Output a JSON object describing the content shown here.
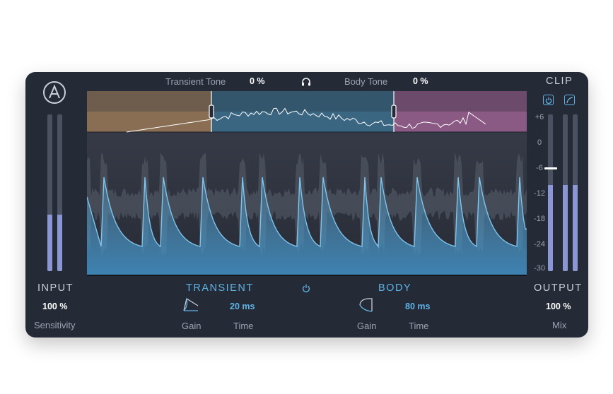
{
  "header": {
    "transient_tone_label": "Transient Tone",
    "transient_tone_value": "0 %",
    "body_tone_label": "Body Tone",
    "body_tone_value": "0 %",
    "clip_label": "CLIP"
  },
  "input": {
    "label": "INPUT",
    "value": "100 %",
    "caption": "Sensitivity",
    "level_left": 0.36,
    "level_right": 0.36
  },
  "output": {
    "label": "OUTPUT",
    "value": "100 %",
    "caption": "Mix",
    "level_left": 0.55,
    "level_right": 0.55,
    "gain_db": -6
  },
  "db_scale": [
    "+6",
    "0",
    "-6",
    "-12",
    "-18",
    "-24",
    "-30"
  ],
  "transient": {
    "label": "TRANSIENT",
    "gain_caption": "Gain",
    "time_caption": "Time",
    "time_value": "20 ms"
  },
  "body": {
    "label": "BODY",
    "gain_caption": "Gain",
    "time_caption": "Time",
    "time_value": "80 ms"
  },
  "colors": {
    "panel": "#242a36",
    "accent": "#5fb3e6",
    "meter_fill": "#8a97d4",
    "band_low": "#8a6e53",
    "band_mid": "#3a6682",
    "band_high": "#8a5a84"
  },
  "icons": {
    "logo": "arturia-logo",
    "monitor": "headphones-icon",
    "clip_power": "power-icon",
    "clip_curve": "curve-icon",
    "bypass": "power-icon",
    "transient_shape": "transient-shape-icon",
    "body_shape": "body-shape-icon"
  }
}
